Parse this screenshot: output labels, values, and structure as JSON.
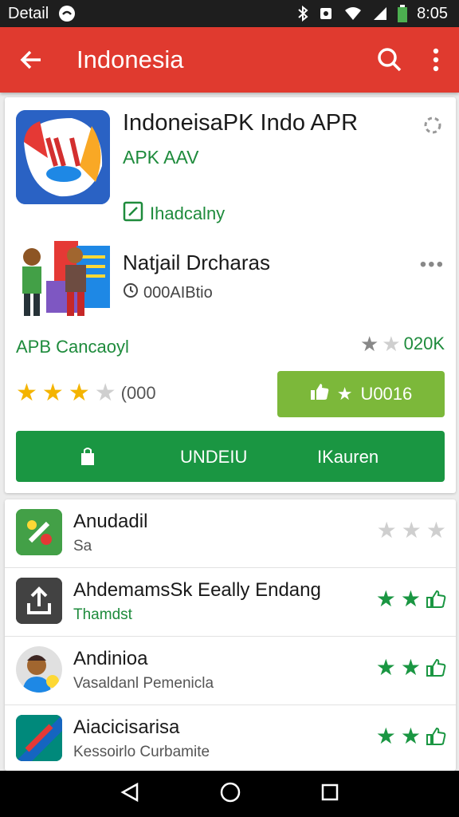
{
  "status_bar": {
    "left_text": "Detail",
    "time": "8:05"
  },
  "app_bar": {
    "title": "Indonesia",
    "icons": [
      "back-arrow-icon",
      "search-icon",
      "more-vert-icon"
    ]
  },
  "app_card": {
    "title": "IndoneisaPK Indo APR",
    "subtitle": "APK AAV",
    "tag": "Ihadcalny",
    "developer_name": "Natjail Drcharas",
    "developer_meta": "000AIBtio",
    "category": "APB Cancaoyl",
    "top_rating": "020K",
    "rating_count": "(000",
    "rate_button_label": "U0016",
    "install_label_1": "UNDEIU",
    "install_label_2": "IKauren"
  },
  "related_apps": [
    {
      "title": "Anudadil",
      "subtitle": "Sa",
      "stars": 0,
      "subtitle_green": false
    },
    {
      "title": "AhdemamsSk Eeally Endang",
      "subtitle": "Thamdst",
      "stars": 2,
      "subtitle_green": true
    },
    {
      "title": "Andinioa",
      "subtitle": "Vasaldanl Pemenicla",
      "stars": 2,
      "subtitle_green": false
    },
    {
      "title": "Aiacicisarisa",
      "subtitle": "Kessoirlo Curbamite",
      "stars": 2,
      "subtitle_green": false
    }
  ],
  "colors": {
    "app_bar": "#e03a2f",
    "green": "#1a9642",
    "light_green": "#7cb83a",
    "star": "#f4b400"
  }
}
